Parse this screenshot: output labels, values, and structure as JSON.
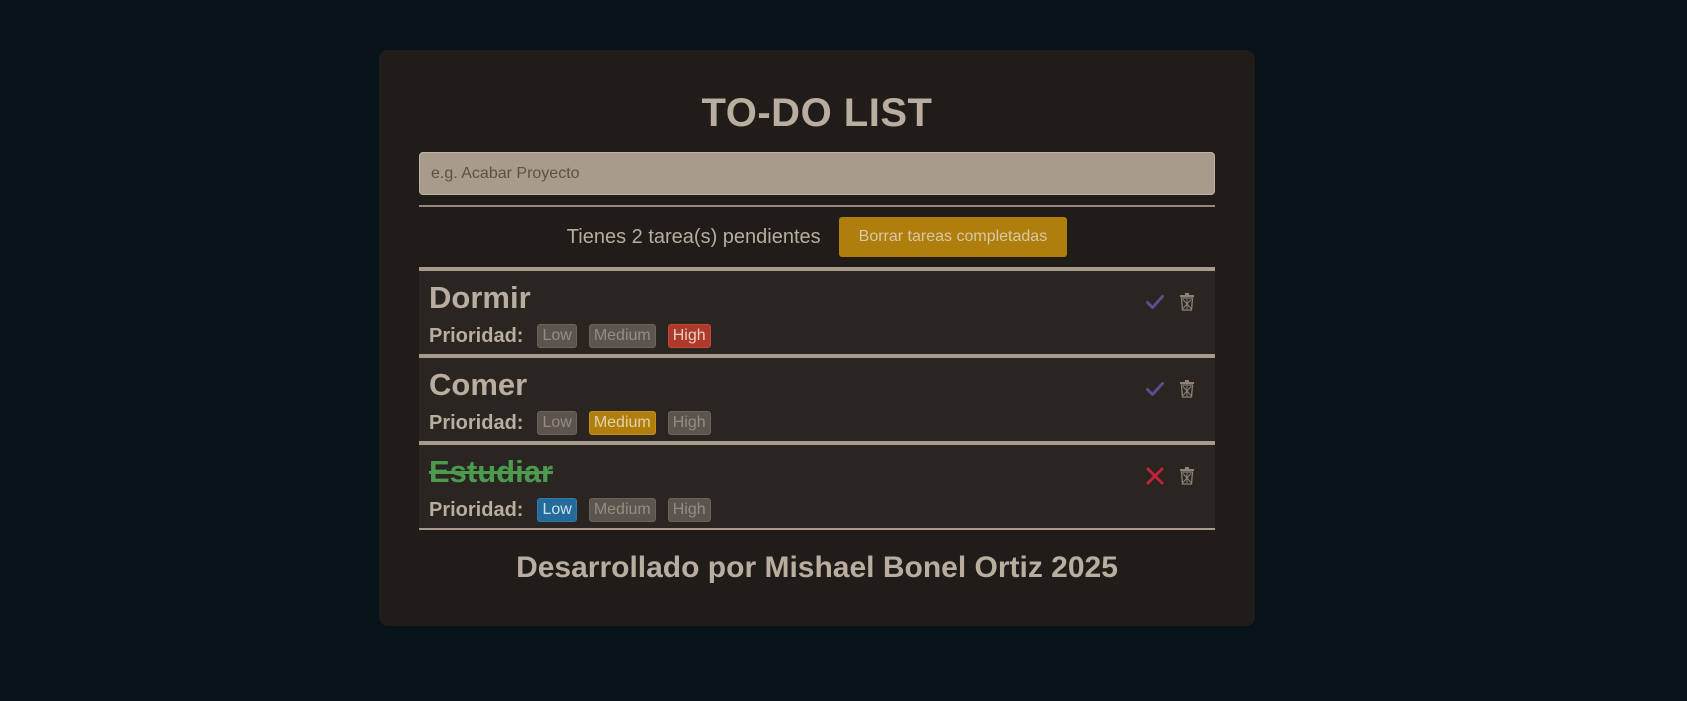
{
  "app": {
    "title": "TO-DO LIST"
  },
  "input": {
    "placeholder": "e.g. Acabar Proyecto",
    "value": ""
  },
  "status": {
    "pending_text": "Tienes 2 tarea(s) pendientes",
    "clear_button_label": "Borrar tareas completadas"
  },
  "priority_label": "Prioridad:",
  "priority_levels": [
    "Low",
    "Medium",
    "High"
  ],
  "tasks": [
    {
      "name": "Dormir",
      "priority": "High",
      "completed": false
    },
    {
      "name": "Comer",
      "priority": "Medium",
      "completed": false
    },
    {
      "name": "Estudiar",
      "priority": "Low",
      "completed": true
    }
  ],
  "footer": {
    "text": "Desarrollado por Mishael Bonel Ortiz 2025"
  },
  "colors": {
    "background": "#081219",
    "card": "#201c19",
    "task_row": "#2a2521",
    "text": "#b8ad9e",
    "input_bg": "#a89b8b",
    "accent_button": "#b07e0c",
    "priority_high": "#b03a2a",
    "priority_medium": "#b07e0c",
    "priority_low": "#246a9a",
    "completed_text": "#4c9a4d",
    "check_icon": "#5b4c8f",
    "undo_icon": "#c0233a"
  },
  "icons": {
    "complete": "check-icon",
    "undo": "close-icon",
    "delete": "trash-icon"
  }
}
